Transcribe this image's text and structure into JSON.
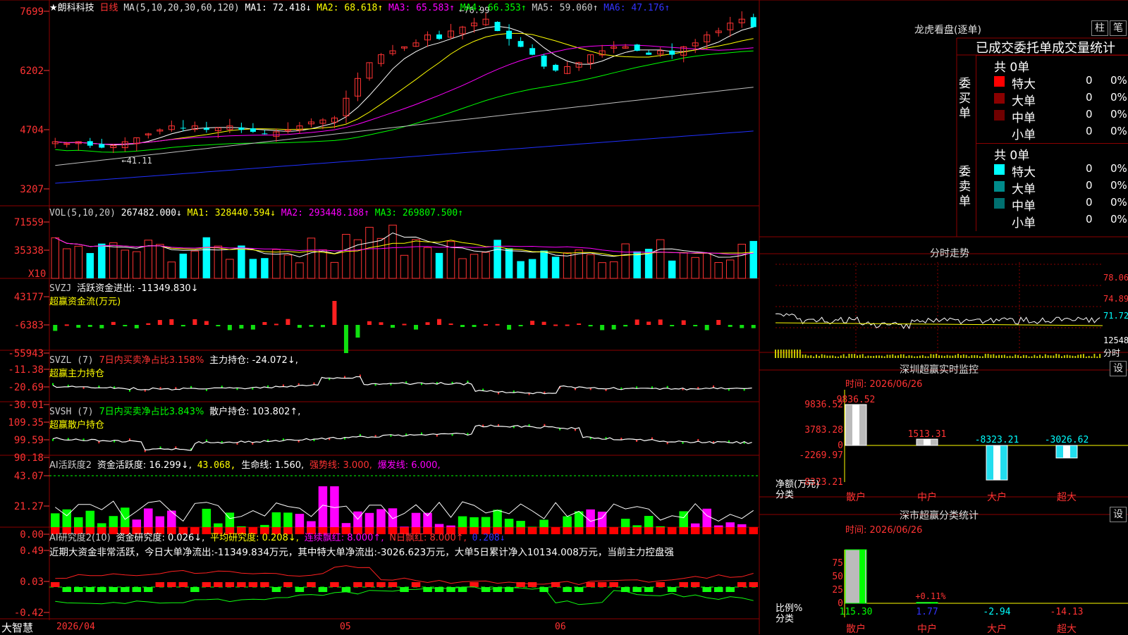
{
  "colors": {
    "up": "#ff3333",
    "down": "#00ffff",
    "grid": "#8b0000",
    "ma1": "#ffffff",
    "ma2": "#ffff00",
    "ma3": "#ff00ff",
    "ma4": "#00ff00",
    "ma5": "#c0c0c0",
    "ma6": "#2030ff",
    "green": "#00ff00",
    "magenta": "#ff00ff"
  },
  "stock": {
    "name": "★朗科科技",
    "period": "日线",
    "ma_label": "MA(5,10,20,30,60,120)",
    "ma1": "MA1: 72.418↓",
    "ma2": "MA2: 68.618↑",
    "ma3": "MA3: 65.583↑",
    "ma4": "MA4: 66.353↑",
    "ma5": "MA5: 59.060↑",
    "ma6": "MA6: 47.176↑",
    "high_mark": "76.99",
    "low_mark": "41.11"
  },
  "price_axis": [
    "7699",
    "6202",
    "4704",
    "3207"
  ],
  "vol": {
    "label": "VOL(5,10,20)",
    "value": "267482.000↓",
    "ma1": "MA1: 328440.594↓",
    "ma2": "MA2: 293448.188↑",
    "ma3": "MA3: 269807.500↑",
    "axis": [
      "71559",
      "35338"
    ],
    "unit": "X10"
  },
  "svzj": {
    "label": "SVZJ",
    "name": "活跃资金进出: -11349.830↓",
    "sub": "超赢资金流(万元)",
    "axis": [
      "43177",
      "-6383",
      "-55943"
    ]
  },
  "svzl": {
    "label": "SVZL (7)",
    "pct": "7日内买卖净占比3.158%",
    "hold": "主力持仓: -24.072↓,",
    "sub": "超赢主力持仓",
    "axis": [
      "-11.38",
      "-20.69",
      "-30.01"
    ]
  },
  "svsh": {
    "label": "SVSH (7)",
    "pct": "7日内买卖净占比3.843%",
    "hold": "散户持仓: 103.802↑,",
    "sub": "超赢散户持仓",
    "axis": [
      "109.35",
      "99.59",
      "90.18"
    ]
  },
  "ai1": {
    "label": "AI活跃度2",
    "v1": "资金活跃度: 16.299↓,",
    "v2": "43.068,",
    "v3": "生命线: 1.560,",
    "v4": "强势线: 3.000,",
    "v5": "爆发线: 6.000,",
    "axis": [
      "43.07",
      "21.27",
      "0.00"
    ]
  },
  "ai2": {
    "label": "AI研究度2(10)",
    "v1": "资金研究度: 0.026↓,",
    "v2": "平均研究度: 0.208↓,",
    "v3": "连续飘红: 8.000↑,",
    "v4": "N日飘红: 8.000↑,",
    "v5": "0.208↓",
    "text": "近期大资金非常活跃，今日大单净流出:-11349.834万元，其中特大单净流出:-3026.623万元，大单5日累计净入10134.008万元，当前主力控盘强",
    "axis": [
      "0.49",
      "0.03",
      "-0.42"
    ]
  },
  "xaxis": {
    "brand": "大智慧",
    "d1": "2026/04",
    "d2": "05",
    "d3": "06"
  },
  "lhb": {
    "title": "龙虎看盘(逐单)",
    "btn1": "柱",
    "btn2": "笔",
    "head": "已成交委托单成交量统计",
    "buy_label": "委买单",
    "sell_label": "委卖单",
    "buy_total": "共 0单",
    "sell_total": "共 0单",
    "buy": [
      {
        "name": "特大",
        "v": "0",
        "p": "0%",
        "c": "#ff0000"
      },
      {
        "name": "大单",
        "v": "0",
        "p": "0%",
        "c": "#8b0000"
      },
      {
        "name": "中单",
        "v": "0",
        "p": "0%",
        "c": "#700000"
      },
      {
        "name": "小单",
        "v": "0",
        "p": "0%",
        "c": "#000000"
      }
    ],
    "sell": [
      {
        "name": "特大",
        "v": "0",
        "p": "0%",
        "c": "#00ffff"
      },
      {
        "name": "大单",
        "v": "0",
        "p": "0%",
        "c": "#008b8b"
      },
      {
        "name": "中单",
        "v": "0",
        "p": "0%",
        "c": "#007070"
      },
      {
        "name": "小单",
        "v": "0",
        "p": "0%",
        "c": "#000000"
      }
    ]
  },
  "fenshi": {
    "title": "分时走势",
    "axis": [
      "78.06",
      "74.89",
      "71.72",
      "12548",
      "分时"
    ]
  },
  "sz_monitor": {
    "title": "深圳超赢实时监控",
    "btn": "设",
    "time": "时间: 2026/06/26",
    "ylabels": [
      "9836.52",
      "3783.28",
      "0",
      "-2269.97",
      "-8323.21"
    ],
    "yunit": "净额(万元)",
    "xunit": "分类",
    "cats": [
      {
        "name": "散户",
        "value": 9836.52,
        "label": "9836.52"
      },
      {
        "name": "中户",
        "value": 1513.31,
        "label": "1513.31"
      },
      {
        "name": "大户",
        "value": -8323.21,
        "label": "-8323.21"
      },
      {
        "name": "超大",
        "value": -3026.62,
        "label": "-3026.62"
      }
    ]
  },
  "sz_class": {
    "title": "深市超赢分类统计",
    "btn": "设",
    "time": "时间: 2026/06/26",
    "ylabels": [
      "75",
      "50",
      "25",
      "0"
    ],
    "yunit": "比例%",
    "xunit": "分类",
    "pct_label": "+0.11%",
    "cats": [
      {
        "name": "散户",
        "value": 115.3,
        "label": "115.30"
      },
      {
        "name": "中户",
        "value": 1.77,
        "label": "1.77"
      },
      {
        "name": "大户",
        "value": -2.94,
        "label": "-2.94"
      },
      {
        "name": "超大",
        "value": -14.13,
        "label": "-14.13"
      }
    ]
  }
}
